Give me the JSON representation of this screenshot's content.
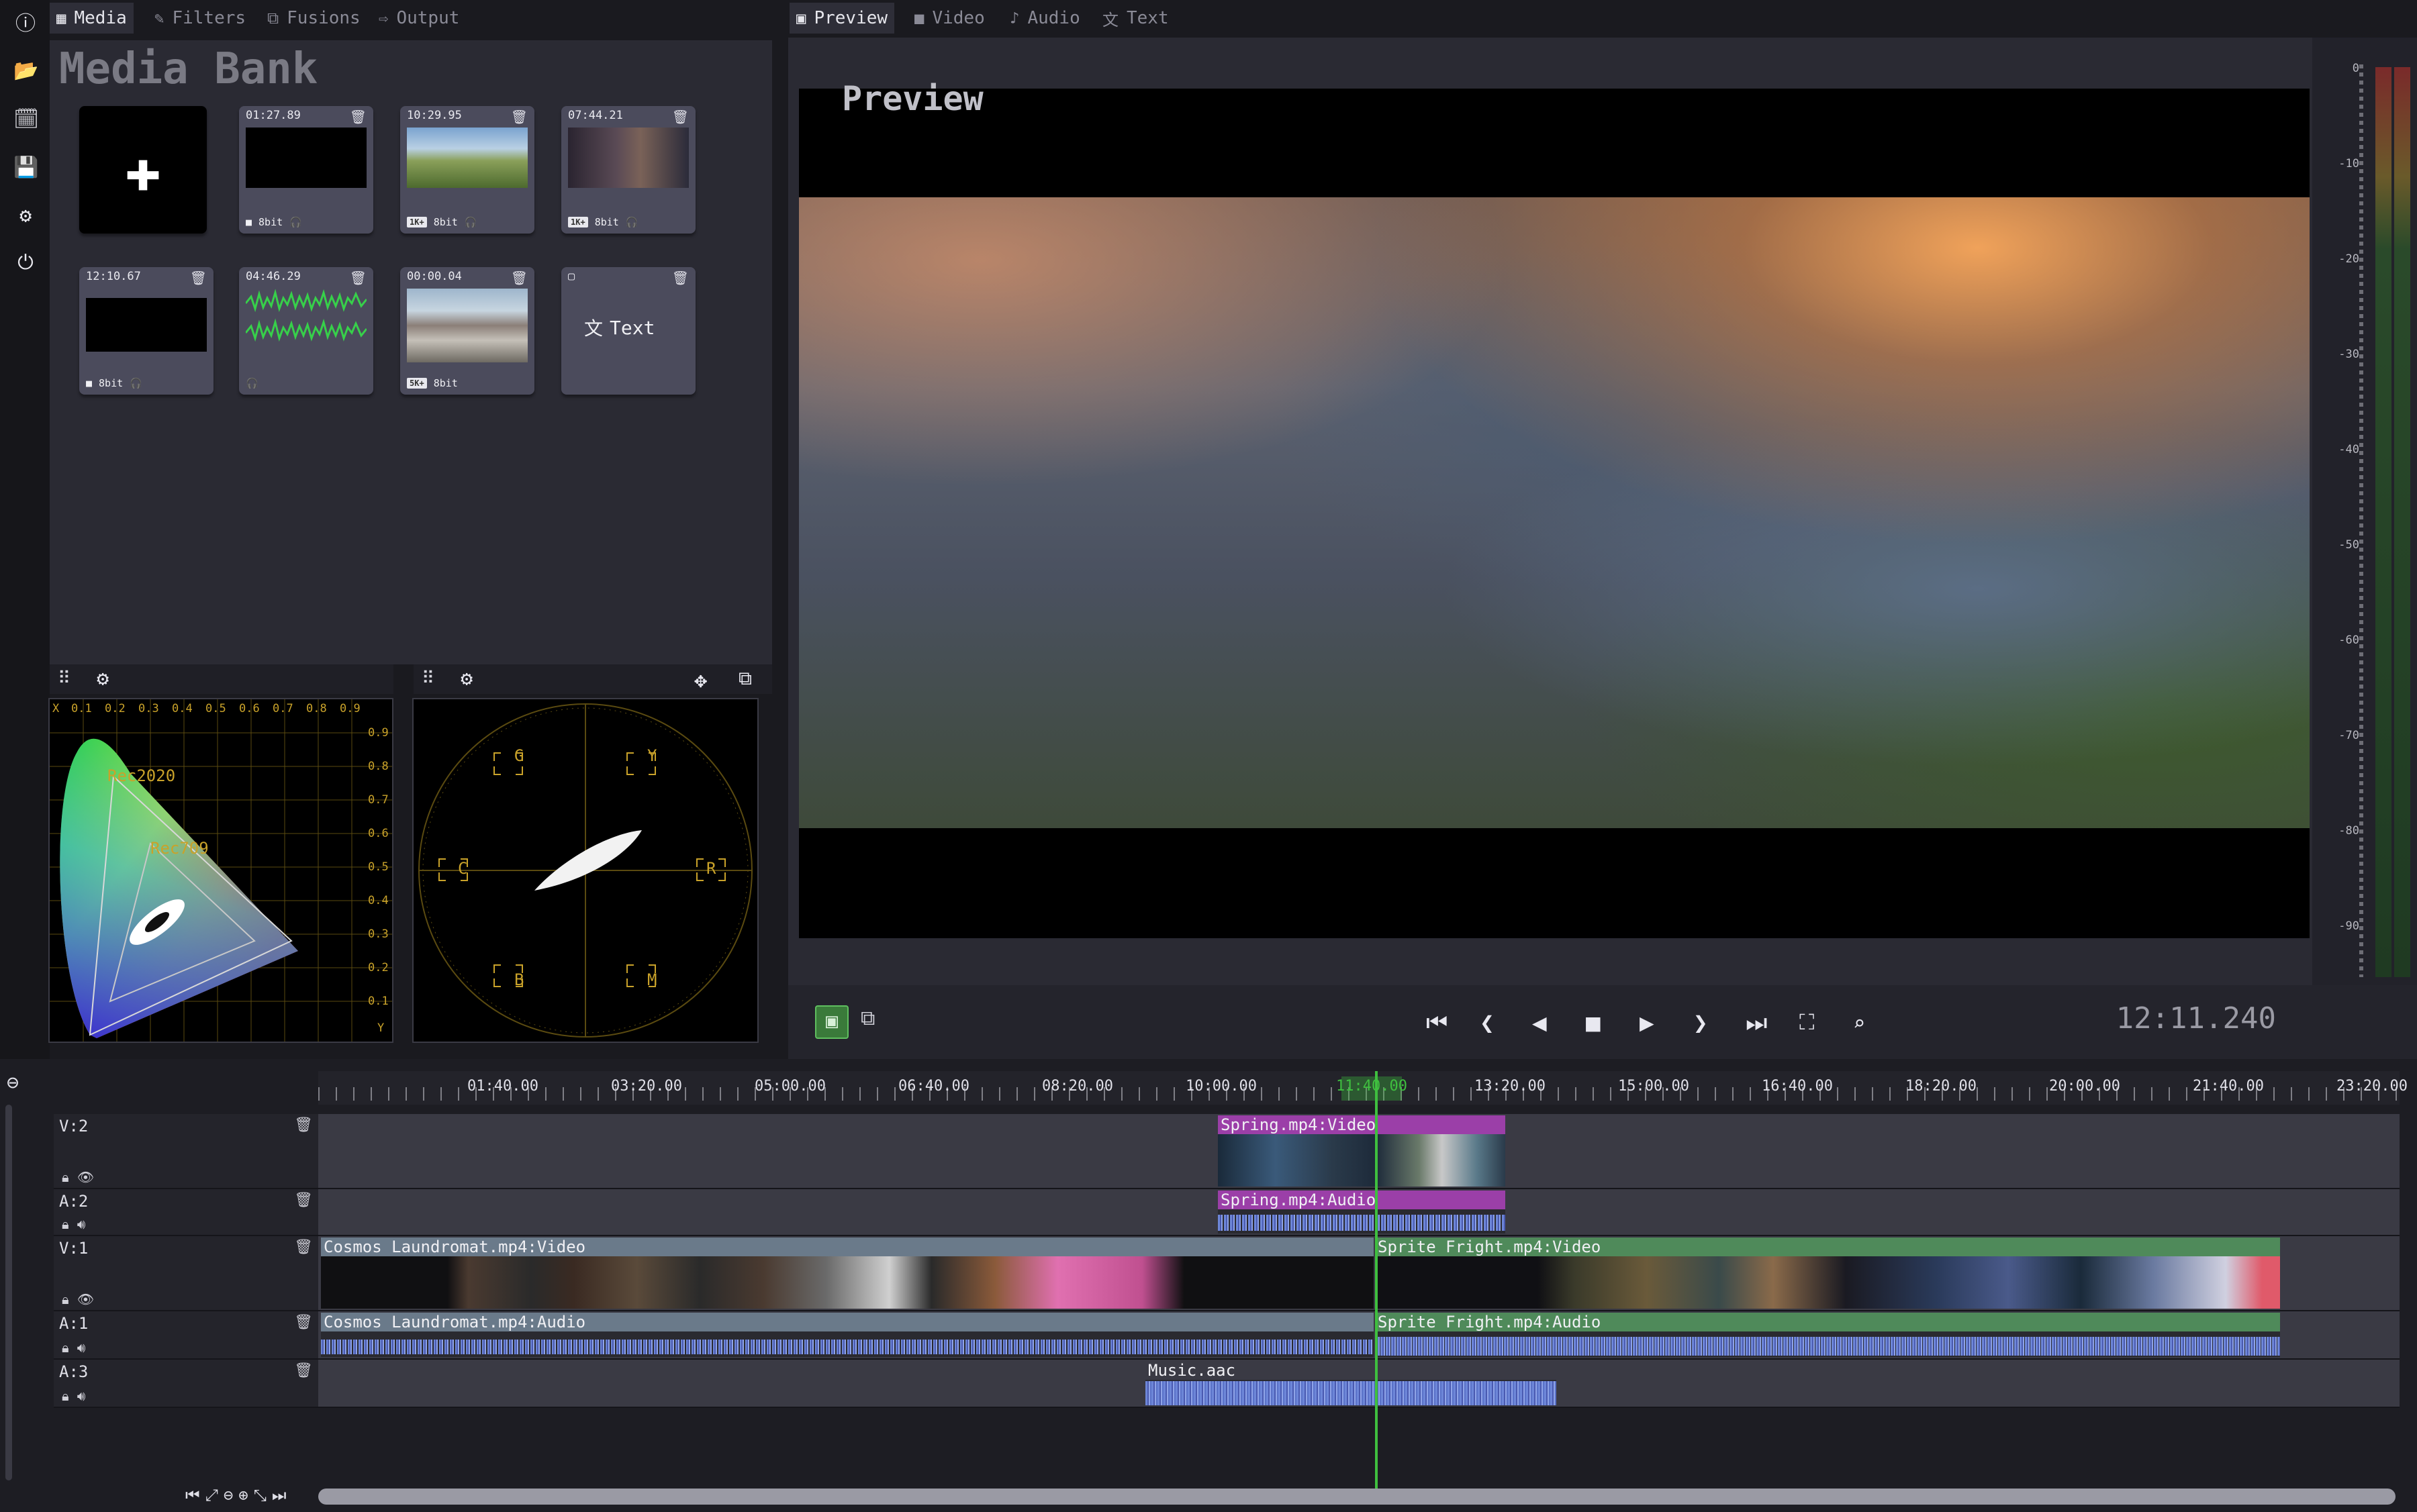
{
  "tabs_left": [
    {
      "label": "Media",
      "icon": "grid-icon"
    },
    {
      "label": "Filters",
      "icon": "wand-icon"
    },
    {
      "label": "Fusions",
      "icon": "fusion-icon"
    },
    {
      "label": "Output",
      "icon": "export-icon"
    }
  ],
  "tabs_right": [
    {
      "label": "Preview",
      "icon": "preview-icon"
    },
    {
      "label": "Video",
      "icon": "video-icon"
    },
    {
      "label": "Audio",
      "icon": "music-icon"
    },
    {
      "label": "Text",
      "icon": "translate-icon"
    }
  ],
  "media_bank": {
    "title": "Media Bank",
    "tiles": [
      {
        "timecode": "01:27.89",
        "depth": "8bit"
      },
      {
        "timecode": "10:29.95",
        "res": "1K+",
        "depth": "8bit"
      },
      {
        "timecode": "07:44.21",
        "res": "1K+",
        "depth": "8bit"
      },
      {
        "timecode": "12:10.67",
        "depth": "8bit"
      },
      {
        "timecode": "04:46.29"
      },
      {
        "timecode": "00:00.04",
        "res": "5K+",
        "depth": "8bit"
      },
      {
        "text_label": "Text"
      }
    ]
  },
  "gamut_scope": {
    "x_ticks": [
      "X",
      "0.1",
      "0.2",
      "0.3",
      "0.4",
      "0.5",
      "0.6",
      "0.7",
      "0.8",
      "0.9"
    ],
    "y_ticks": [
      "0.9",
      "0.8",
      "0.7",
      "0.6",
      "0.5",
      "0.4",
      "0.3",
      "0.2",
      "0.1",
      "Y"
    ],
    "labels": [
      "Rec2020",
      "Rec709"
    ]
  },
  "vectorscope": {
    "labels": [
      "G",
      "Y",
      "C",
      "R",
      "B",
      "M"
    ]
  },
  "preview": {
    "title": "Preview"
  },
  "meter": {
    "ticks": [
      "0",
      "-10",
      "-20",
      "-30",
      "-40",
      "-50",
      "-60",
      "-70",
      "-80",
      "-90"
    ]
  },
  "transport": {
    "timecode": "12:11.240"
  },
  "timeline": {
    "ruler": [
      "01:40.00",
      "03:20.00",
      "05:00.00",
      "06:40.00",
      "08:20.00",
      "10:00.00",
      "11:40.00",
      "13:20.00",
      "15:00.00",
      "16:40.00",
      "18:20.00",
      "20:00.00",
      "21:40.00",
      "23:20.00"
    ],
    "tracks": [
      {
        "name": "V:2"
      },
      {
        "name": "A:2"
      },
      {
        "name": "V:1"
      },
      {
        "name": "A:1"
      },
      {
        "name": "A:3"
      }
    ],
    "clips": {
      "spring_video": "Spring.mp4:Video",
      "spring_audio": "Spring.mp4:Audio",
      "cosmos_video": "Cosmos Laundromat.mp4:Video",
      "sprite_video": "Sprite Fright.mp4:Video",
      "cosmos_audio": "Cosmos Laundromat.mp4:Audio",
      "sprite_audio": "Sprite Fright.mp4:Audio",
      "music": "Music.aac"
    }
  },
  "colors": {
    "accent_green": "#3fbf3f",
    "clip_purple": "#9b3fa8",
    "clip_grey": "#6a7a8a",
    "clip_green": "#4f8a5a",
    "audio_blue": "#6d86d8"
  }
}
